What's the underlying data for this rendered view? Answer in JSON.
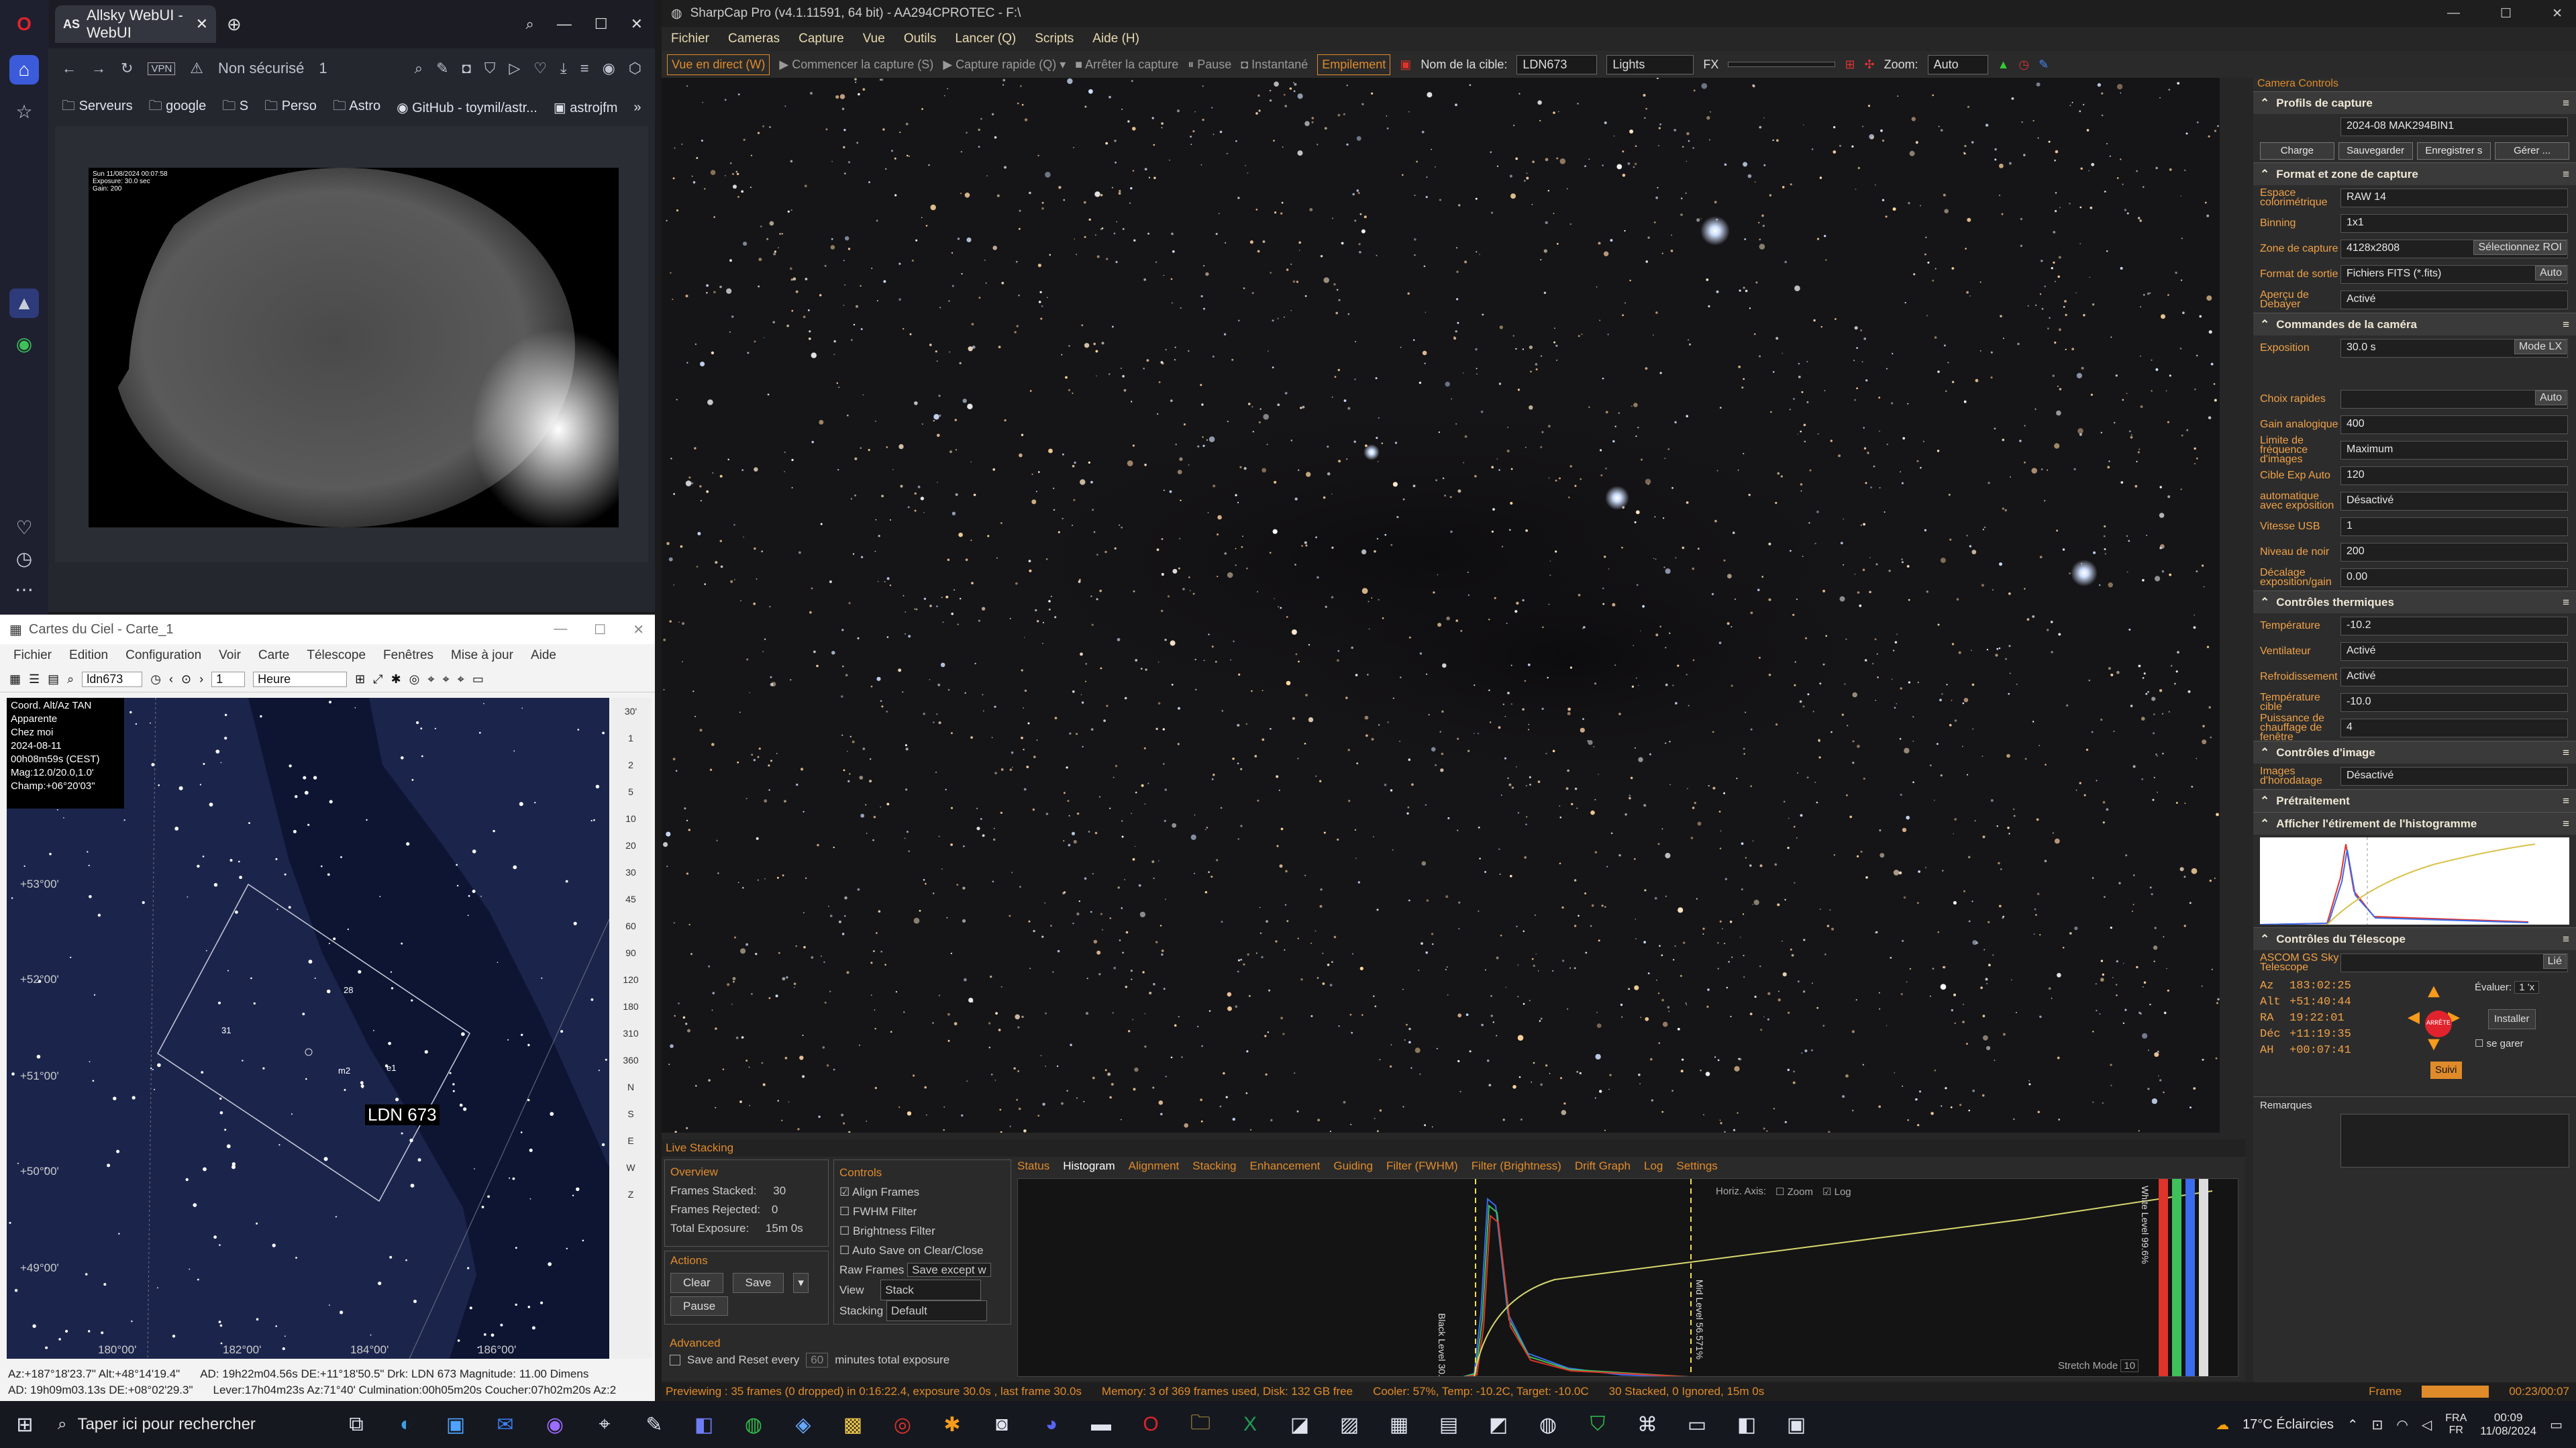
{
  "browser": {
    "tab_prefix": "AS",
    "tab_title": "Allsky WebUI - WebUI",
    "security": "Non sécurisé",
    "security_count": "1",
    "bookmarks": [
      "Serveurs",
      "google",
      "S",
      "Perso",
      "Astro",
      "GitHub - toymil/astr...",
      "astrojfm"
    ],
    "cam_overlay": [
      "Sun 11/08/2024 00:07:58",
      "Exposure: 30.0 sec",
      "Gain: 200"
    ]
  },
  "cdc": {
    "title": "Cartes du Ciel - Carte_1",
    "menu": [
      "Fichier",
      "Edition",
      "Configuration",
      "Voir",
      "Carte",
      "Télescope",
      "Fenêtres",
      "Mise à jour",
      "Aide"
    ],
    "object_field": "ldn673",
    "step": "1",
    "unit": "Heure",
    "info": [
      "Coord. Alt/Az TAN",
      "Apparente",
      "Chez moi",
      "2024-08-11",
      "00h08m59s (CEST)",
      "Mag:12.0/20.0,1.0'",
      "Champ:+06°20'03\""
    ],
    "dec_labels": [
      "+53°00'",
      "+52°00'",
      "+51°00'",
      "+50°00'",
      "+49°00'"
    ],
    "ra_labels": [
      "180°00'",
      "182°00'",
      "184°00'",
      "186°00'"
    ],
    "target_label": "LDN 673",
    "star_labels": [
      "28",
      "31",
      "m2",
      "e1"
    ],
    "right_tools": [
      "30'",
      "1",
      "2",
      "5",
      "10",
      "20",
      "30",
      "45",
      "60",
      "90",
      "120",
      "180",
      "310",
      "360",
      "N",
      "S",
      "E",
      "W",
      "Z"
    ],
    "status": [
      "Az:+187°18'23.7\" Alt:+48°14'19.4\"",
      "AD: 19h09m03.13s DE:+08°02'29.3\"",
      "AD: 19h22m04.56s DE:+11°18'50.5\"  Drk: LDN 673   Magnitude: 11.00   Dimens",
      "Lever:17h04m23s Az:71°40'   Culmination:00h05m20s   Coucher:07h02m20s Az:2"
    ]
  },
  "sharpcap": {
    "title": "SharpCap Pro (v4.1.11591, 64 bit) - AA294CPROTEC - F:\\",
    "menu": [
      "Fichier",
      "Cameras",
      "Capture",
      "Vue",
      "Outils",
      "Lancer (Q)",
      "Scripts",
      "Aide (H)"
    ],
    "toolbar": {
      "live": "Vue en direct (W)",
      "start": "Commencer la capture (S)",
      "quick": "Capture rapide (Q)",
      "stop": "Arrêter la capture",
      "pause": "Pause",
      "snap": "Instantané",
      "stack": "Empilement",
      "target_label": "Nom de la cible:",
      "target": "LDN673",
      "frame_type": "Lights",
      "fx": "FX",
      "zoom_label": "Zoom:",
      "zoom": "Auto"
    },
    "panel": {
      "header": "Camera Controls",
      "sections": [
        {
          "title": "Profils de capture",
          "rows": [
            {
              "l": "",
              "v": "2024-08 MAK294BIN1"
            }
          ],
          "buttons": [
            "Charge",
            "Sauvegarder",
            "Enregistrer s",
            "Gérer ..."
          ]
        },
        {
          "title": "Format et zone de capture",
          "rows": [
            {
              "l": "Espace colorimétrique",
              "v": "RAW 14"
            },
            {
              "l": "Binning",
              "v": "1x1"
            },
            {
              "l": "Zone de capture",
              "v": "4128x2808",
              "b": "Sélectionnez ROI"
            },
            {
              "l": "Format de sortie",
              "v": "Fichiers FITS (*.fits)",
              "b": "Auto"
            },
            {
              "l": "Aperçu de Debayer",
              "v": "Activé"
            }
          ]
        },
        {
          "title": "Commandes de la caméra",
          "rows": [
            {
              "l": "Exposition",
              "v": "30.0 s",
              "b": "Mode LX"
            },
            {
              "l": "",
              "v": ""
            },
            {
              "l": "Choix rapides",
              "v": "",
              "b": "Auto"
            },
            {
              "l": "Gain analogique",
              "v": "400"
            },
            {
              "l": "Limite de fréquence d'images",
              "v": "Maximum"
            },
            {
              "l": "Cible Exp Auto",
              "v": "120"
            },
            {
              "l": "automatique avec exposition",
              "v": "Désactivé"
            },
            {
              "l": "Vitesse USB",
              "v": "1"
            },
            {
              "l": "Niveau de noir",
              "v": "200"
            },
            {
              "l": "Décalage exposition/gain",
              "v": "0.00"
            }
          ]
        },
        {
          "title": "Contrôles thermiques",
          "rows": [
            {
              "l": "Température",
              "v": "-10.2"
            },
            {
              "l": "Ventilateur",
              "v": "Activé"
            },
            {
              "l": "Refroidissement",
              "v": "Activé"
            },
            {
              "l": "Température cible",
              "v": "-10.0"
            },
            {
              "l": "Puissance de chauffage de fenêtre",
              "v": "4"
            }
          ]
        },
        {
          "title": "Contrôles d'image",
          "rows": [
            {
              "l": "Images d'horodatage",
              "v": "Désactivé"
            }
          ]
        },
        {
          "title": "Prétraitement",
          "rows": []
        },
        {
          "title": "Afficher l'étirement de l'histogramme",
          "rows": []
        },
        {
          "title": "Contrôles du Télescope",
          "rows": [
            {
              "l": "ASCOM GS Sky Telescope",
              "v": "",
              "b": "Lié"
            }
          ]
        }
      ],
      "telescope": {
        "az": "183:02:25",
        "alt": "+51:40:44",
        "ra": "19:22:01",
        "dec": "+11:19:35",
        "ah": "+00:07:41",
        "evaluer": "Évaluer:",
        "rate": "1 'x",
        "install": "Installer",
        "suivi": "Suivi",
        "gare": "se garer",
        "stop": "ARRÊTE",
        "remarks": "Remarques"
      }
    },
    "live_stacking": {
      "title": "Live Stacking",
      "overview": {
        "label": "Overview",
        "stacked": "Frames Stacked:",
        "stacked_v": "30",
        "rejected": "Frames Rejected:",
        "rejected_v": "0",
        "total": "Total Exposure:",
        "total_v": "15m 0s"
      },
      "actions": {
        "label": "Actions",
        "clear": "Clear",
        "save": "Save",
        "pause": "Pause"
      },
      "advanced": {
        "label": "Advanced",
        "save_reset": "Save and Reset every",
        "minutes": "60",
        "minutes_label": "minutes total exposure"
      },
      "controls": {
        "label": "Controls",
        "align": "Align Frames",
        "fwhm": "FWHM Filter",
        "bright": "Brightness Filter",
        "autosave": "Auto Save on Clear/Close",
        "raw_label": "Raw Frames",
        "raw": "Save except w",
        "view_label": "View",
        "view": "Stack",
        "stacking_label": "Stacking",
        "stacking": "Default"
      },
      "tabs": [
        "Status",
        "Histogram",
        "Alignment",
        "Stacking",
        "Enhancement",
        "Guiding",
        "Filter (FWHM)",
        "Filter (Brightness)",
        "Drift Graph",
        "Log",
        "Settings"
      ],
      "histo": {
        "horiz": "Horiz. Axis:",
        "zoom": "Zoom",
        "log": "Log",
        "black": "Black Level 30.560%",
        "mid": "Mid Level 56.571%",
        "white": "White Level 99.6%",
        "stretch": "Stretch Mode",
        "stretch_v": "10"
      }
    },
    "status": [
      "Previewing : 35 frames (0 dropped) in 0:16:22.4, exposure 30.0s , last frame 30.0s",
      "Memory: 3 of 369 frames used, Disk: 132 GB free",
      "Cooler: 57%, Temp: -10.2C, Target: -10.0C",
      "30 Stacked, 0 Ignored, 15m 0s",
      "Frame",
      "00:23/00:07"
    ]
  },
  "taskbar": {
    "search": "Taper ici pour rechercher",
    "weather": "17°C  Éclaircies",
    "lang": "FRA",
    "lang2": "FR",
    "time": "00:09",
    "date": "11/08/2024"
  },
  "colors": {
    "accent": "#e08b2a",
    "scene": "#151416",
    "cdc_sky": "#1b254c"
  }
}
